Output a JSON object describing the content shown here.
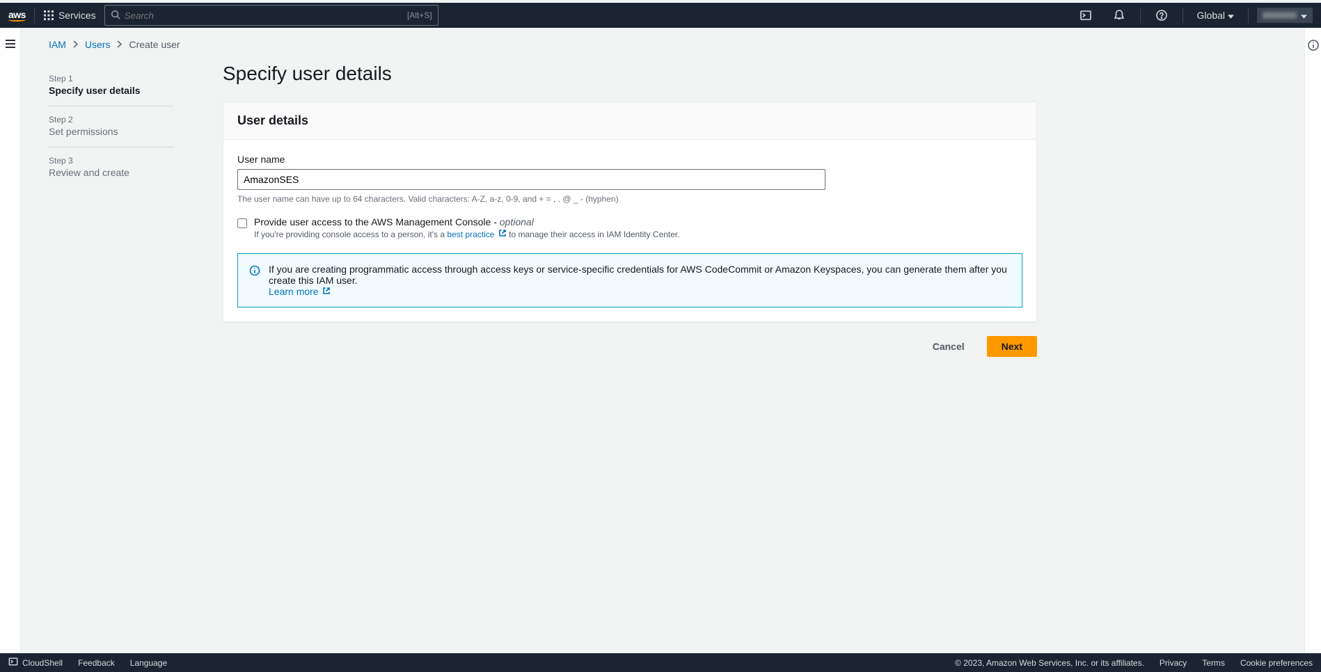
{
  "topnav": {
    "services_label": "Services",
    "search_placeholder": "Search",
    "search_shortcut": "[Alt+S]",
    "region": "Global"
  },
  "breadcrumb": {
    "iam": "IAM",
    "users": "Users",
    "current": "Create user"
  },
  "stepper": [
    {
      "label": "Step 1",
      "title": "Specify user details",
      "active": true
    },
    {
      "label": "Step 2",
      "title": "Set permissions",
      "active": false
    },
    {
      "label": "Step 3",
      "title": "Review and create",
      "active": false
    }
  ],
  "page": {
    "title": "Specify user details",
    "panel_title": "User details",
    "username_label": "User name",
    "username_value": "AmazonSES",
    "username_helper": "The user name can have up to 64 characters. Valid characters: A-Z, a-z, 0-9, and + = , . @ _ - (hyphen)",
    "console_access_label_main": "Provide user access to the AWS Management Console - ",
    "console_access_label_optional": "optional",
    "console_access_desc_prefix": "If you're providing console access to a person, it's a ",
    "console_access_desc_link": "best practice",
    "console_access_desc_suffix": " to manage their access in IAM Identity Center.",
    "info_text": "If you are creating programmatic access through access keys or service-specific credentials for AWS CodeCommit or Amazon Keyspaces, you can generate them after you create this IAM user.",
    "info_link": "Learn more"
  },
  "actions": {
    "cancel": "Cancel",
    "next": "Next"
  },
  "footer": {
    "cloudshell": "CloudShell",
    "feedback": "Feedback",
    "language": "Language",
    "copyright": "© 2023, Amazon Web Services, Inc. or its affiliates.",
    "privacy": "Privacy",
    "terms": "Terms",
    "cookies": "Cookie preferences"
  }
}
